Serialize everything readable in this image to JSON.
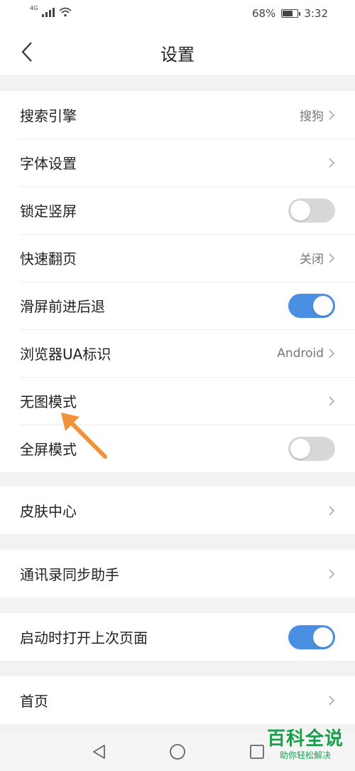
{
  "status_bar": {
    "network": "4G",
    "battery": "68%",
    "battery_level": 0.68,
    "time": "3:32"
  },
  "header": {
    "title": "设置",
    "back_icon": "chevron-left-icon"
  },
  "groups": [
    {
      "rows": [
        {
          "label": "搜索引擎",
          "value": "搜狗",
          "control": "chevron"
        },
        {
          "label": "字体设置",
          "value": "",
          "control": "chevron"
        },
        {
          "label": "锁定竖屏",
          "control": "toggle",
          "toggle_on": false
        },
        {
          "label": "快速翻页",
          "value": "关闭",
          "control": "chevron"
        },
        {
          "label": "滑屏前进后退",
          "control": "toggle",
          "toggle_on": true
        },
        {
          "label": "浏览器UA标识",
          "value": "Android",
          "control": "chevron"
        },
        {
          "label": "无图模式",
          "value": "",
          "control": "chevron"
        },
        {
          "label": "全屏模式",
          "control": "toggle",
          "toggle_on": false
        }
      ]
    },
    {
      "rows": [
        {
          "label": "皮肤中心",
          "value": "",
          "control": "chevron"
        }
      ]
    },
    {
      "rows": [
        {
          "label": "通讯录同步助手",
          "value": "",
          "control": "chevron"
        }
      ]
    },
    {
      "rows": [
        {
          "label": "启动时打开上次页面",
          "control": "toggle",
          "toggle_on": true
        }
      ]
    },
    {
      "rows": [
        {
          "label": "首页",
          "value": "",
          "control": "chevron"
        }
      ]
    }
  ],
  "nav": {
    "back_icon": "triangle-back-icon",
    "home_icon": "circle-home-icon",
    "recents_icon": "square-recents-icon"
  },
  "watermark": {
    "title": "百科全说",
    "subtitle": "助你轻松解决"
  },
  "colors": {
    "accent": "#4a90e2",
    "toggle_off": "#d8d8d8",
    "annotation_arrow": "#f0923a",
    "watermark": "#1b9e4b"
  }
}
